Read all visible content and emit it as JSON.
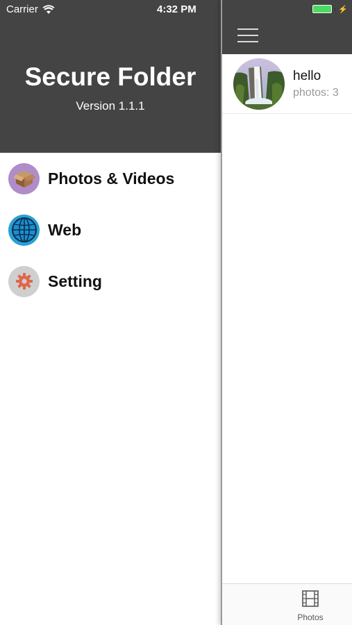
{
  "status_bar": {
    "carrier": "Carrier",
    "time": "4:32 PM",
    "battery_level": 1.0,
    "battery_color": "#4cd964",
    "charging_icon": "bolt-icon"
  },
  "drawer": {
    "header_bg": "#444444",
    "title": "Secure Folder",
    "version": "Version 1.1.1",
    "items": [
      {
        "label": "Photos & Videos",
        "icon": "box-icon",
        "icon_bg": "#b08cc8"
      },
      {
        "label": "Web",
        "icon": "globe-icon",
        "icon_bg": "#2a9fd6"
      },
      {
        "label": "Setting",
        "icon": "gear-icon",
        "icon_bg": "#cfcfcf"
      }
    ]
  },
  "main": {
    "nav_icon": "hamburger-menu-icon",
    "folders": [
      {
        "name": "hello",
        "count": "photos: 3",
        "thumbnail": "waterfall-thumbnail"
      }
    ],
    "tab_bar": {
      "tabs": [
        {
          "label": "Photos",
          "icon": "film-icon"
        }
      ]
    }
  }
}
